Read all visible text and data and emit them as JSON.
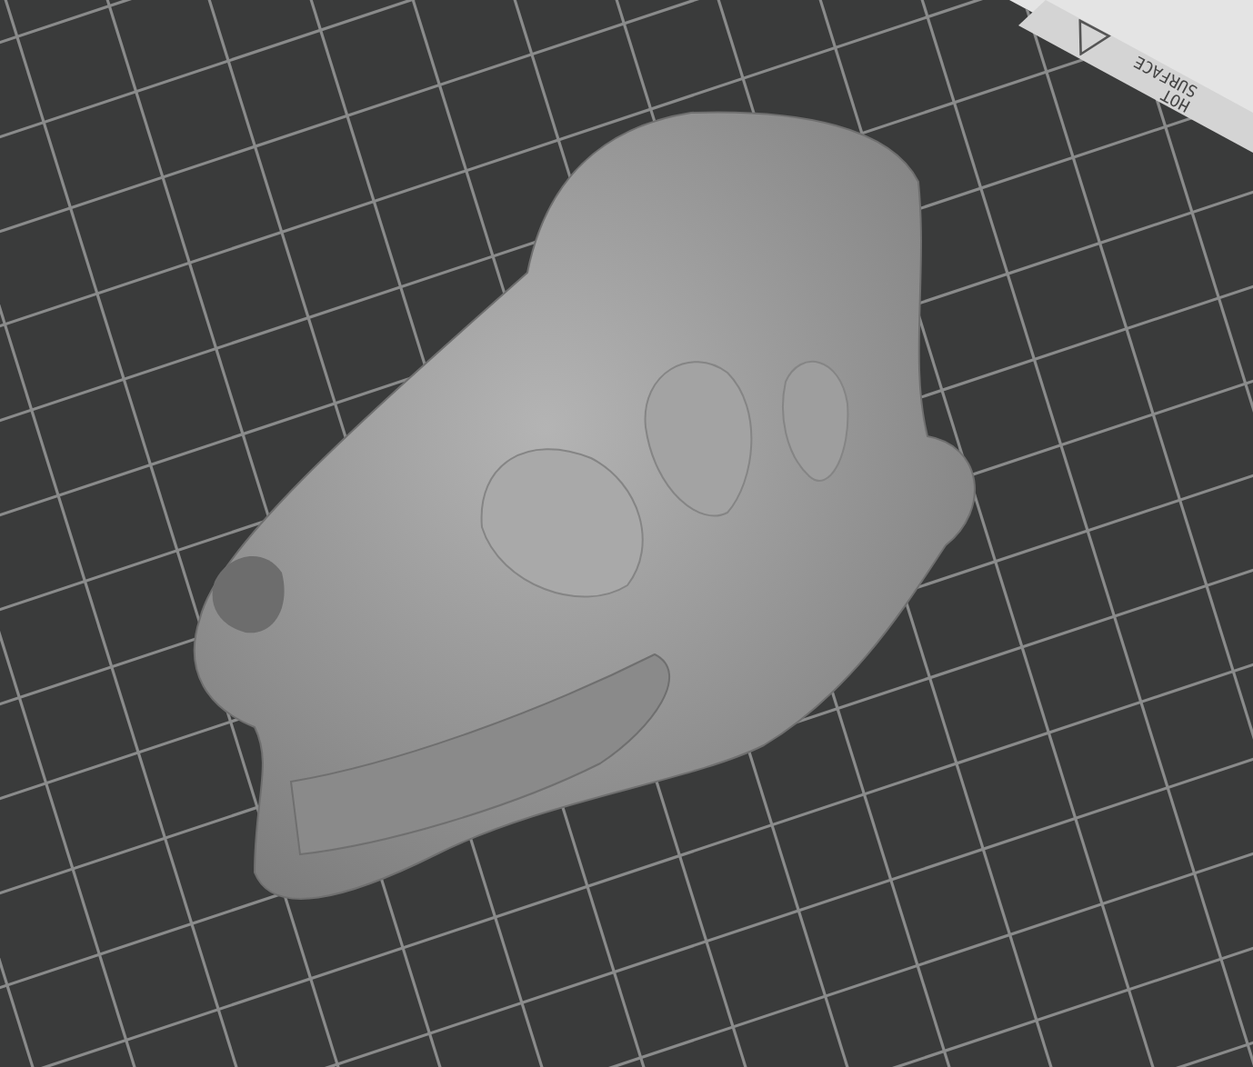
{
  "viewport": {
    "plate_label": "HOT SURFACE"
  }
}
